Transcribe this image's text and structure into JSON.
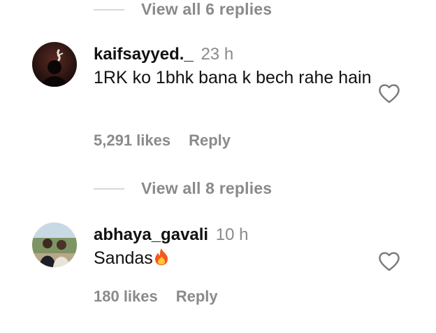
{
  "threads": [
    {
      "view_replies": "View all 6 replies"
    },
    {
      "view_replies": "View all 8 replies"
    }
  ],
  "comments": [
    {
      "username": "kaifsayyed._",
      "time": "23 h",
      "text": "1RK ko 1bhk bana k bech rahe hain",
      "likes": "5,291 likes",
      "reply": "Reply"
    },
    {
      "username": "abhaya_gavali",
      "time": "10 h",
      "text": "Sandas",
      "emoji": "fire-emoji",
      "likes": "180 likes",
      "reply": "Reply"
    }
  ],
  "icons": {
    "like": "heart-outline-icon"
  },
  "colors": {
    "secondary_text": "#8a8a8a",
    "primary_text": "#111111",
    "divider": "#d7d7d7"
  }
}
